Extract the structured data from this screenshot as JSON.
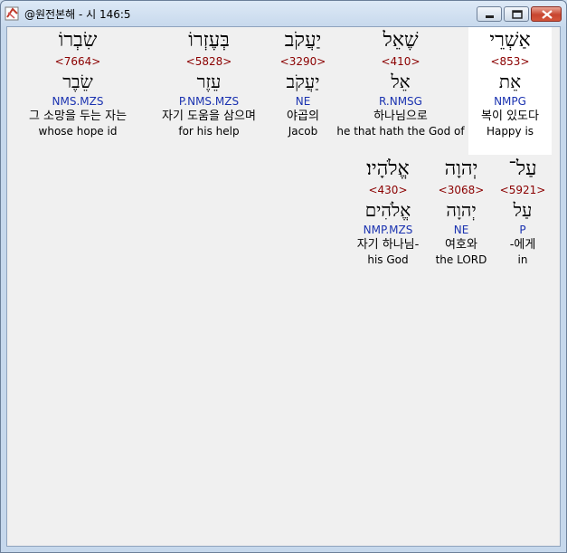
{
  "window": {
    "title": "@원전본해 - 시 146:5",
    "buttons": {
      "minimize": "minimize",
      "maximize": "maximize",
      "close": "close"
    }
  },
  "words": [
    {
      "heb": "אַשְׁרֵי",
      "strong": "<853>",
      "lemma": "אֵת",
      "parse": "NMPG",
      "kor": "복이 있도다",
      "eng": "Happy is",
      "highlight": true
    },
    {
      "heb": "שֶׁאֵל",
      "strong": "<410>",
      "lemma": "אֵל",
      "parse": "R.NMSG",
      "kor": "하나님으로",
      "eng": "he that hath the God of",
      "highlight": false
    },
    {
      "heb": "יַעֲקֹב",
      "strong": "<3290>",
      "lemma": "יַעֲקֹב",
      "parse": "NE",
      "kor": "야곱의",
      "eng": "Jacob",
      "highlight": false
    },
    {
      "heb": "בְּעֶזְרוֹ",
      "strong": "<5828>",
      "lemma": "עֵזֶר",
      "parse": "P.NMS.MZS",
      "kor": "자기 도움을 삼으며",
      "eng": "for his help",
      "highlight": false
    },
    {
      "heb": "שִׂבְרוֹ",
      "strong": "<7664>",
      "lemma": "שֵׂבֶר",
      "parse": "NMS.MZS",
      "kor": "그 소망을 두는 자는",
      "eng": "whose hope id",
      "highlight": false
    },
    {
      "heb": "עַל־",
      "strong": "<5921>",
      "lemma": "עַל",
      "parse": "P",
      "kor": "-에게",
      "eng": "in",
      "highlight": false
    },
    {
      "heb": "יְהוָה",
      "strong": "<3068>",
      "lemma": "יְהוָה",
      "parse": "NE",
      "kor": "여호와",
      "eng": "the LORD",
      "highlight": false
    },
    {
      "heb": "אֱלֹהָיו׃",
      "strong": "<430>",
      "lemma": "אֱלֹהִים",
      "parse": "NMP.MZS",
      "kor": "자기 하나님-",
      "eng": "his God",
      "highlight": false
    }
  ]
}
